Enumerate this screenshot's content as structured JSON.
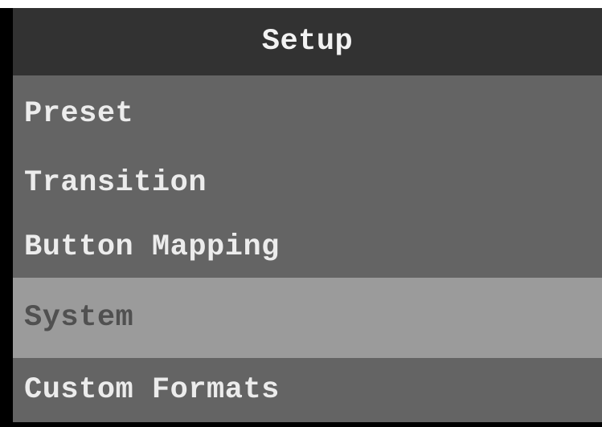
{
  "header": {
    "title": "Setup"
  },
  "menu": {
    "items": [
      {
        "label": "Preset",
        "selected": false
      },
      {
        "label": "Transition",
        "selected": false
      },
      {
        "label": "Button Mapping",
        "selected": false
      },
      {
        "label": "System",
        "selected": true
      },
      {
        "label": "Custom Formats",
        "selected": false
      }
    ]
  },
  "colors": {
    "header_bg": "#323232",
    "menu_bg": "#646464",
    "selected_bg": "#9b9b9b",
    "text": "#ececec",
    "selected_text": "#505050"
  }
}
